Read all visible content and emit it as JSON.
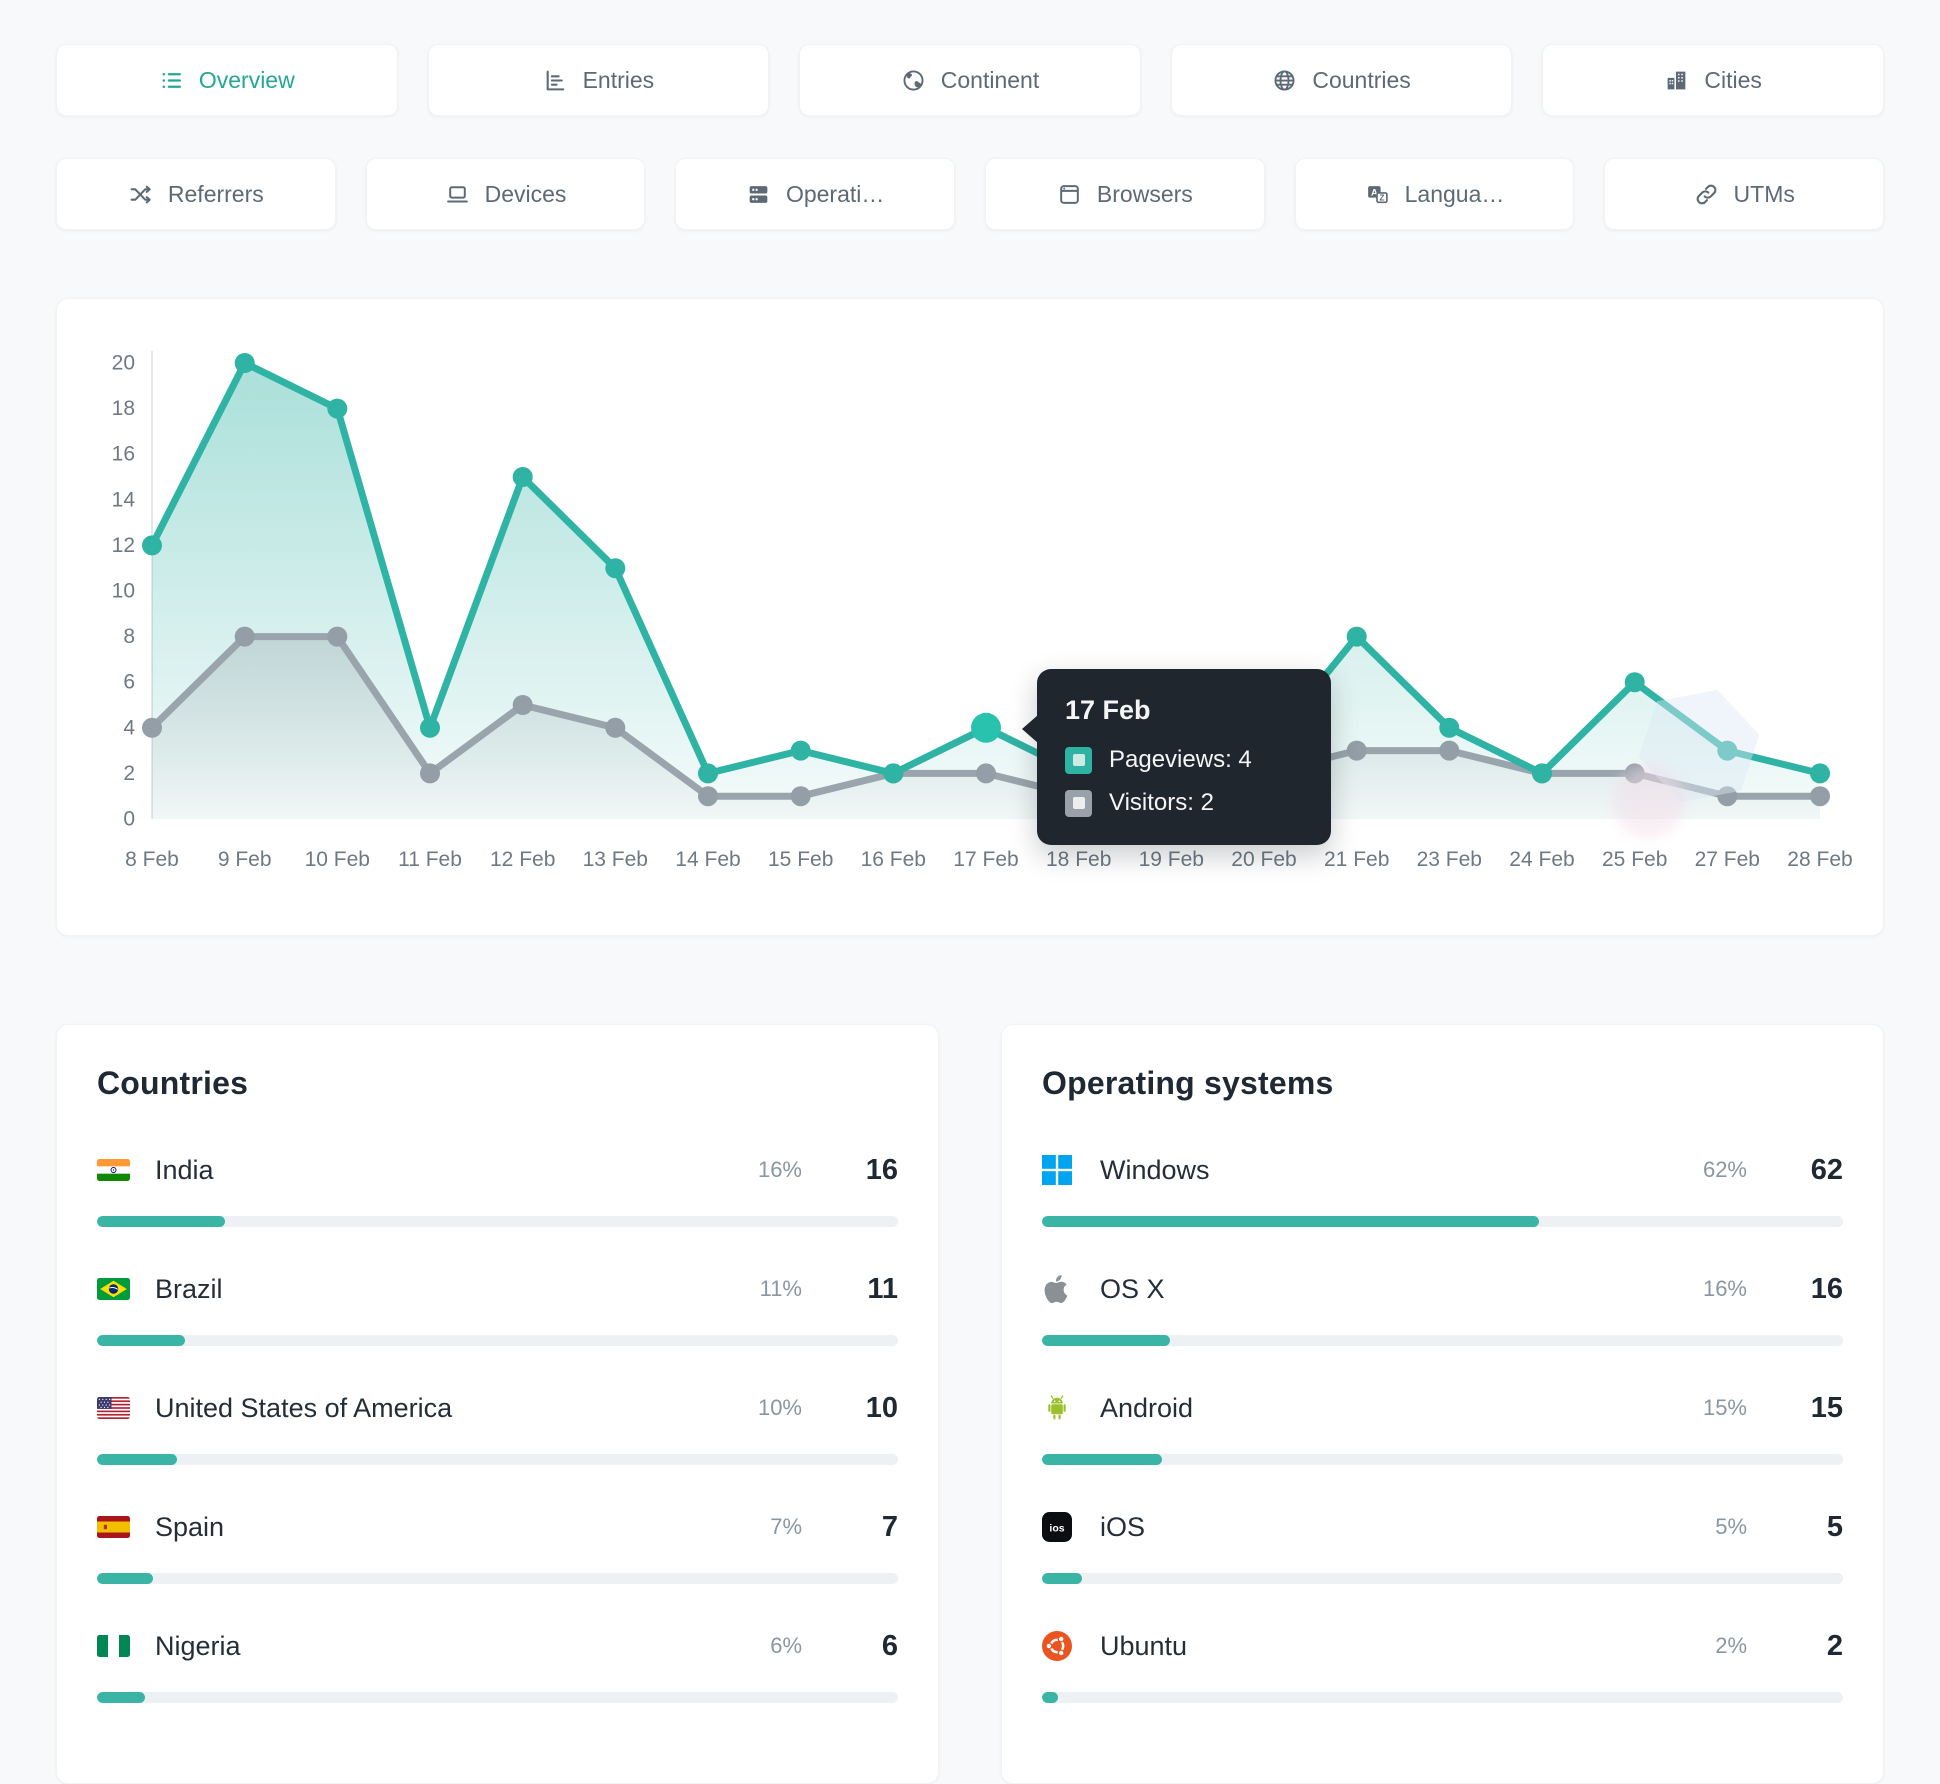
{
  "tabs_row1": [
    {
      "label": "Overview",
      "icon": "list-icon",
      "active": true
    },
    {
      "label": "Entries",
      "icon": "ranking-icon",
      "active": false
    },
    {
      "label": "Continent",
      "icon": "continent-icon",
      "active": false
    },
    {
      "label": "Countries",
      "icon": "globe-icon",
      "active": false
    },
    {
      "label": "Cities",
      "icon": "city-icon",
      "active": false
    }
  ],
  "tabs_row2": [
    {
      "label": "Referrers",
      "icon": "shuffle-icon",
      "active": false
    },
    {
      "label": "Devices",
      "icon": "laptop-icon",
      "active": false
    },
    {
      "label": "Operati…",
      "icon": "server-icon",
      "active": false
    },
    {
      "label": "Browsers",
      "icon": "browser-icon",
      "active": false
    },
    {
      "label": "Langua…",
      "icon": "language-icon",
      "active": false
    },
    {
      "label": "UTMs",
      "icon": "link-icon",
      "active": false
    }
  ],
  "chart_data": {
    "type": "area",
    "categories": [
      "8 Feb",
      "9 Feb",
      "10 Feb",
      "11 Feb",
      "12 Feb",
      "13 Feb",
      "14 Feb",
      "15 Feb",
      "16 Feb",
      "17 Feb",
      "18 Feb",
      "19 Feb",
      "20 Feb",
      "21 Feb",
      "23 Feb",
      "24 Feb",
      "25 Feb",
      "27 Feb",
      "28 Feb"
    ],
    "series": [
      {
        "name": "Pageviews",
        "color": "#2fb3a4",
        "values": [
          12,
          20,
          18,
          4,
          15,
          11,
          2,
          3,
          2,
          4,
          2,
          3,
          3,
          8,
          4,
          2,
          6,
          3,
          2
        ]
      },
      {
        "name": "Visitors",
        "color": "#99a4ac",
        "values": [
          4,
          8,
          8,
          2,
          5,
          4,
          1,
          1,
          2,
          2,
          1,
          1,
          2,
          3,
          3,
          2,
          2,
          1,
          1
        ]
      }
    ],
    "ylim": [
      0,
      20
    ],
    "yticks": [
      0,
      2,
      4,
      6,
      8,
      10,
      12,
      14,
      16,
      18,
      20
    ],
    "grid": "none",
    "legend_position": "none",
    "highlight": {
      "series": "Pageviews",
      "index": 9
    }
  },
  "tooltip": {
    "title": "17 Feb",
    "rows": [
      {
        "series": "Pageviews",
        "text": "Pageviews: 4",
        "color": "#2eb3a2"
      },
      {
        "series": "Visitors",
        "text": "Visitors: 2",
        "color": "#99a2ab"
      }
    ]
  },
  "panels": [
    {
      "title": "Countries",
      "rows": [
        {
          "icon": "india-flag",
          "name": "India",
          "pct": "16%",
          "value": "16",
          "bar_pct": 16
        },
        {
          "icon": "brazil-flag",
          "name": "Brazil",
          "pct": "11%",
          "value": "11",
          "bar_pct": 11
        },
        {
          "icon": "usa-flag",
          "name": "United States of America",
          "pct": "10%",
          "value": "10",
          "bar_pct": 10
        },
        {
          "icon": "spain-flag",
          "name": "Spain",
          "pct": "7%",
          "value": "7",
          "bar_pct": 7
        },
        {
          "icon": "nigeria-flag",
          "name": "Nigeria",
          "pct": "6%",
          "value": "6",
          "bar_pct": 6
        }
      ]
    },
    {
      "title": "Operating systems",
      "rows": [
        {
          "icon": "windows-icon",
          "name": "Windows",
          "pct": "62%",
          "value": "62",
          "bar_pct": 62
        },
        {
          "icon": "apple-icon",
          "name": "OS X",
          "pct": "16%",
          "value": "16",
          "bar_pct": 16
        },
        {
          "icon": "android-icon",
          "name": "Android",
          "pct": "15%",
          "value": "15",
          "bar_pct": 15
        },
        {
          "icon": "ios-icon",
          "name": "iOS",
          "pct": "5%",
          "value": "5",
          "bar_pct": 5
        },
        {
          "icon": "ubuntu-icon",
          "name": "Ubuntu",
          "pct": "2%",
          "value": "2",
          "bar_pct": 2
        }
      ]
    }
  ],
  "colors": {
    "accent": "#24a795",
    "pageviews_line": "#2fb3a4",
    "visitors_line": "#99a4ac",
    "highlight_dot": "#29c2af",
    "tooltip_bg": "#20262e",
    "bar_track": "#eef1f3",
    "bar_fill": "#3ab5a5",
    "axis_text": "#6e7983",
    "windows_blue": "#00a4ef",
    "android_green": "#9bc02c",
    "ubuntu_orange": "#e95420",
    "apple_gray": "#8a9096"
  }
}
